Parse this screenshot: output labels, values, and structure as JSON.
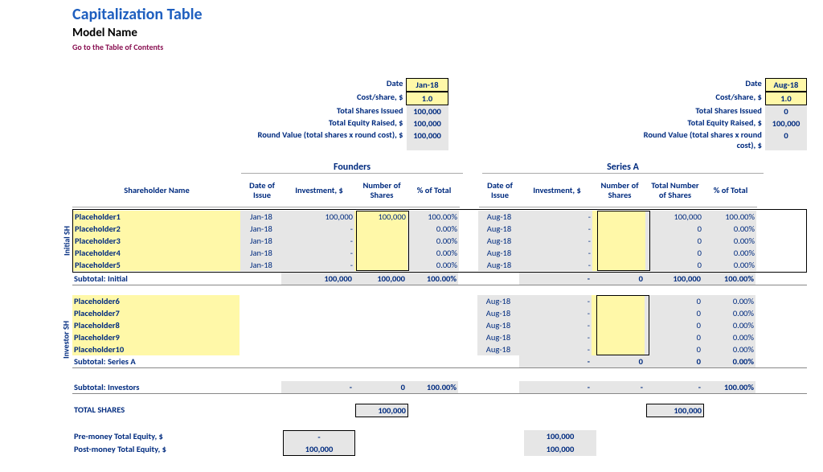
{
  "title": "Capitalization Table",
  "model_name": "Model Name",
  "toc_link": "Go to the Table of Contents",
  "summary_labels": {
    "date": "Date",
    "cost_share": "Cost/share, $",
    "total_shares": "Total Shares Issued",
    "total_equity": "Total Equity Raised, $",
    "round_value": "Round Value (total shares x round cost), $"
  },
  "rounds": [
    {
      "name": "Founders",
      "date": "Jan-18",
      "cost_share": "1.0",
      "total_shares": "100,000",
      "total_equity": "100,000",
      "round_value": "100,000"
    },
    {
      "name": "Series A",
      "date": "Aug-18",
      "cost_share": "1.0",
      "total_shares": "0",
      "total_equity": "100,000",
      "round_value": "0"
    }
  ],
  "col_headers": {
    "shareholder": "Shareholder Name",
    "date_issue": "Date of Issue",
    "investment": "Investment, $",
    "num_shares": "Number of Shares",
    "total_num_shares": "Total Number of Shares",
    "pct_total": "% of Total"
  },
  "sections": {
    "initial": {
      "label": "Initial SH",
      "rows": [
        {
          "name": "Placeholder1",
          "r1": {
            "date": "Jan-18",
            "inv": "100,000",
            "num": "100,000",
            "pct": "100.00%"
          },
          "r2": {
            "date": "Aug-18",
            "inv": "-",
            "num": "",
            "tnum": "100,000",
            "pct": "100.00%"
          }
        },
        {
          "name": "Placeholder2",
          "r1": {
            "date": "Jan-18",
            "inv": "-",
            "num": "",
            "pct": "0.00%"
          },
          "r2": {
            "date": "Aug-18",
            "inv": "-",
            "num": "",
            "tnum": "0",
            "pct": "0.00%"
          }
        },
        {
          "name": "Placeholder3",
          "r1": {
            "date": "Jan-18",
            "inv": "-",
            "num": "",
            "pct": "0.00%"
          },
          "r2": {
            "date": "Aug-18",
            "inv": "-",
            "num": "",
            "tnum": "0",
            "pct": "0.00%"
          }
        },
        {
          "name": "Placeholder4",
          "r1": {
            "date": "Jan-18",
            "inv": "-",
            "num": "",
            "pct": "0.00%"
          },
          "r2": {
            "date": "Aug-18",
            "inv": "-",
            "num": "",
            "tnum": "0",
            "pct": "0.00%"
          }
        },
        {
          "name": "Placeholder5",
          "r1": {
            "date": "Jan-18",
            "inv": "-",
            "num": "",
            "pct": "0.00%"
          },
          "r2": {
            "date": "Aug-18",
            "inv": "-",
            "num": "",
            "tnum": "0",
            "pct": "0.00%"
          }
        }
      ],
      "subtotal": {
        "name": "Subtotal: Initial",
        "r1": {
          "inv": "100,000",
          "num": "100,000",
          "pct": "100.00%"
        },
        "r2": {
          "inv": "-",
          "num": "0",
          "tnum": "100,000",
          "pct": "100.00%"
        }
      }
    },
    "investor": {
      "label": "Investor SH",
      "rows": [
        {
          "name": "Placeholder6",
          "r2": {
            "date": "Aug-18",
            "inv": "-",
            "num": "",
            "tnum": "0",
            "pct": "0.00%"
          }
        },
        {
          "name": "Placeholder7",
          "r2": {
            "date": "Aug-18",
            "inv": "-",
            "num": "",
            "tnum": "0",
            "pct": "0.00%"
          }
        },
        {
          "name": "Placeholder8",
          "r2": {
            "date": "Aug-18",
            "inv": "-",
            "num": "",
            "tnum": "0",
            "pct": "0.00%"
          }
        },
        {
          "name": "Placeholder9",
          "r2": {
            "date": "Aug-18",
            "inv": "-",
            "num": "",
            "tnum": "0",
            "pct": "0.00%"
          }
        },
        {
          "name": "Placeholder10",
          "r2": {
            "date": "Aug-18",
            "inv": "-",
            "num": "",
            "tnum": "0",
            "pct": "0.00%"
          }
        }
      ],
      "subtotal": {
        "name": "Subtotal: Series A",
        "r2": {
          "inv": "-",
          "num": "0",
          "tnum": "0",
          "pct": "0.00%"
        }
      }
    }
  },
  "subtotal_investors": {
    "name": "Subtotal: Investors",
    "r1": {
      "inv": "-",
      "num": "0",
      "pct": "100.00%"
    },
    "r2": {
      "inv": "-",
      "num": "-",
      "tnum": "-",
      "pct": "100.00%"
    }
  },
  "total_shares_label": "TOTAL SHARES",
  "total_shares": {
    "r1": "100,000",
    "r2": "100,000"
  },
  "equity": {
    "pre_label": "Pre-money Total Equity, $",
    "post_label": "Post-money Total Equity, $",
    "r1": {
      "pre": "-",
      "post": "100,000"
    },
    "r2": {
      "pre": "100,000",
      "post": "100,000"
    }
  }
}
